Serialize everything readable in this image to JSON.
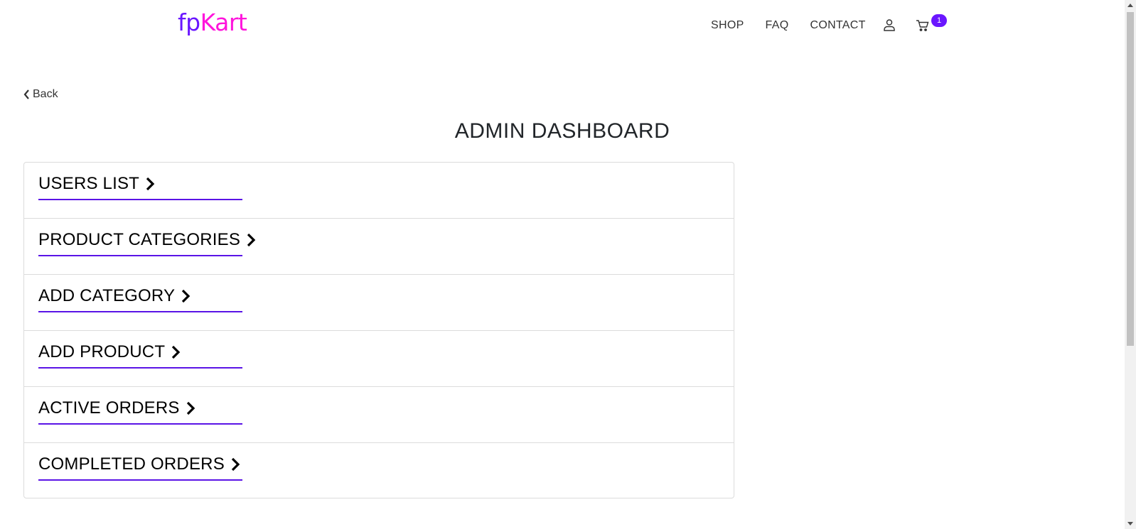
{
  "brand": {
    "part1": "fp",
    "part2": "Kart",
    "color1": "#6a16ff",
    "color2": "#ff14dc"
  },
  "nav": {
    "links": [
      "SHOP",
      "FAQ",
      "CONTACT"
    ],
    "user_icon": "user-icon",
    "cart_icon": "cart-icon",
    "cart_count": "1"
  },
  "back": {
    "label": "Back",
    "icon": "chevron-left-icon"
  },
  "page": {
    "title": "ADMIN DASHBOARD"
  },
  "dashboard": {
    "items": [
      {
        "label": "USERS LIST"
      },
      {
        "label": "PRODUCT CATEGORIES"
      },
      {
        "label": "ADD CATEGORY"
      },
      {
        "label": "ADD PRODUCT"
      },
      {
        "label": "ACTIVE ORDERS"
      },
      {
        "label": "COMPLETED ORDERS"
      }
    ],
    "underline_color": "#5a14e6",
    "chevron_icon": "chevron-right-icon"
  }
}
